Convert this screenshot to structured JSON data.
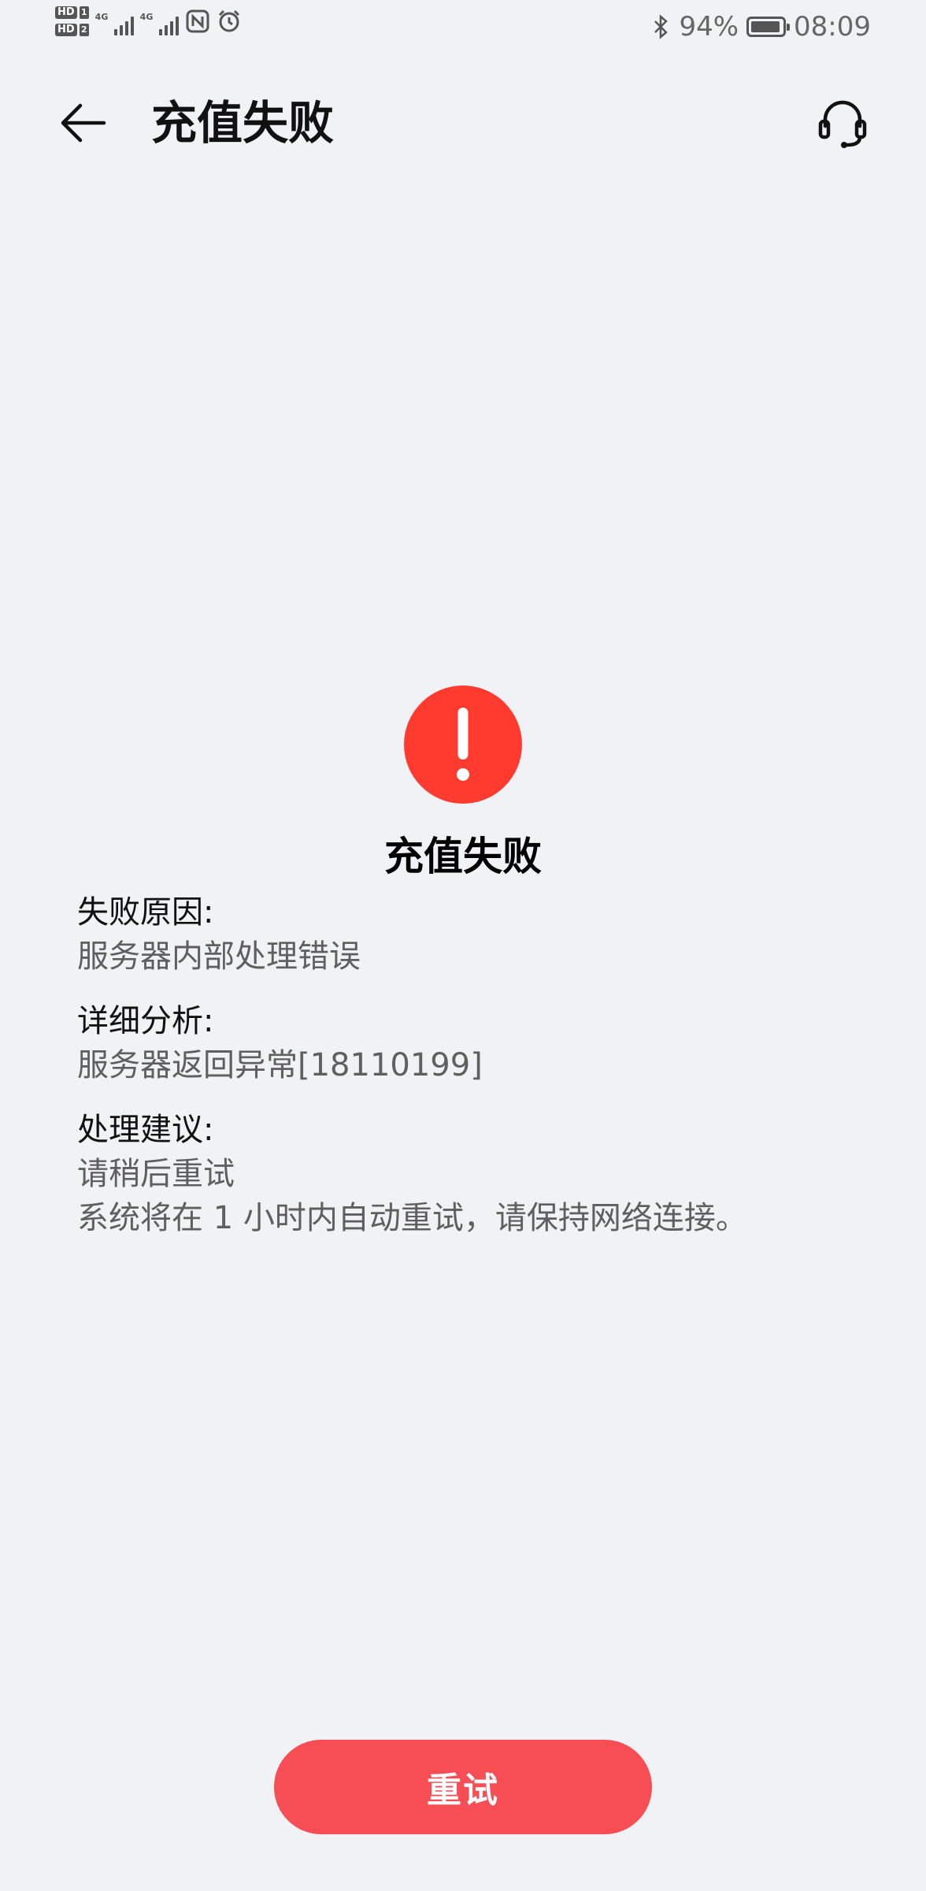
{
  "status_bar": {
    "hd_badge": "HD",
    "slot_1": "1",
    "slot_2": "2",
    "network_1": "4G",
    "network_2": "4G",
    "battery_percent": "94%",
    "battery_level": 0.94,
    "time": "08:09",
    "icons": [
      "nfc-icon",
      "alarm-icon",
      "bluetooth-icon",
      "battery-icon"
    ]
  },
  "header": {
    "title": "充值失败",
    "back_icon": "arrow-left-icon",
    "support_icon": "headset-icon"
  },
  "result": {
    "icon": "error-exclamation-icon",
    "title": "充值失败",
    "colors": {
      "error": "#FF3B30",
      "button": "#F64E54"
    }
  },
  "details": {
    "reason_label": "失败原因:",
    "reason_value": "服务器内部处理错误",
    "analysis_label": "详细分析:",
    "analysis_value": "服务器返回异常[18110199]",
    "suggestion_label": "处理建议:",
    "suggestion_value_1": "请稍后重试",
    "suggestion_value_2": "系统将在 1 小时内自动重试，请保持网络连接。"
  },
  "actions": {
    "retry_label": "重试"
  }
}
